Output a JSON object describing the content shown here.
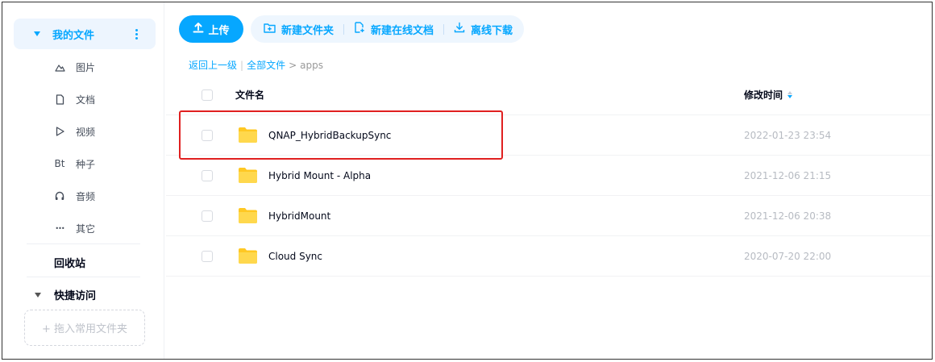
{
  "sidebar": {
    "my_files": "我的文件",
    "categories": [
      {
        "label": "图片",
        "icon": "image-icon"
      },
      {
        "label": "文档",
        "icon": "document-icon"
      },
      {
        "label": "视频",
        "icon": "video-icon"
      },
      {
        "label": "种子",
        "icon": "torrent-icon",
        "glyph": "Bt"
      },
      {
        "label": "音频",
        "icon": "headphones-icon"
      },
      {
        "label": "其它",
        "icon": "more-icon",
        "glyph": "•••"
      }
    ],
    "recycle_bin": "回收站",
    "quick_access": "快捷访问",
    "drop_hint": "+ 拖入常用文件夹"
  },
  "toolbar": {
    "upload": "上传",
    "new_folder": "新建文件夹",
    "new_online_doc": "新建在线文档",
    "offline_download": "离线下载"
  },
  "breadcrumb": {
    "back": "返回上一级",
    "separator": "|",
    "all_files": "全部文件",
    "arrow": ">",
    "current": "apps"
  },
  "table": {
    "col_name": "文件名",
    "col_time": "修改时间",
    "rows": [
      {
        "name": "QNAP_HybridBackupSync",
        "time": "2022-01-23 23:54"
      },
      {
        "name": "Hybrid Mount - Alpha",
        "time": "2021-12-06 21:15"
      },
      {
        "name": "HybridMount",
        "time": "2021-12-06 20:38"
      },
      {
        "name": "Cloud Sync",
        "time": "2020-07-20 22:00"
      }
    ]
  },
  "colors": {
    "accent": "#06a7ff",
    "accent_bg": "#edf5fe",
    "folder": "#ffc823",
    "highlight": "#e02020"
  }
}
